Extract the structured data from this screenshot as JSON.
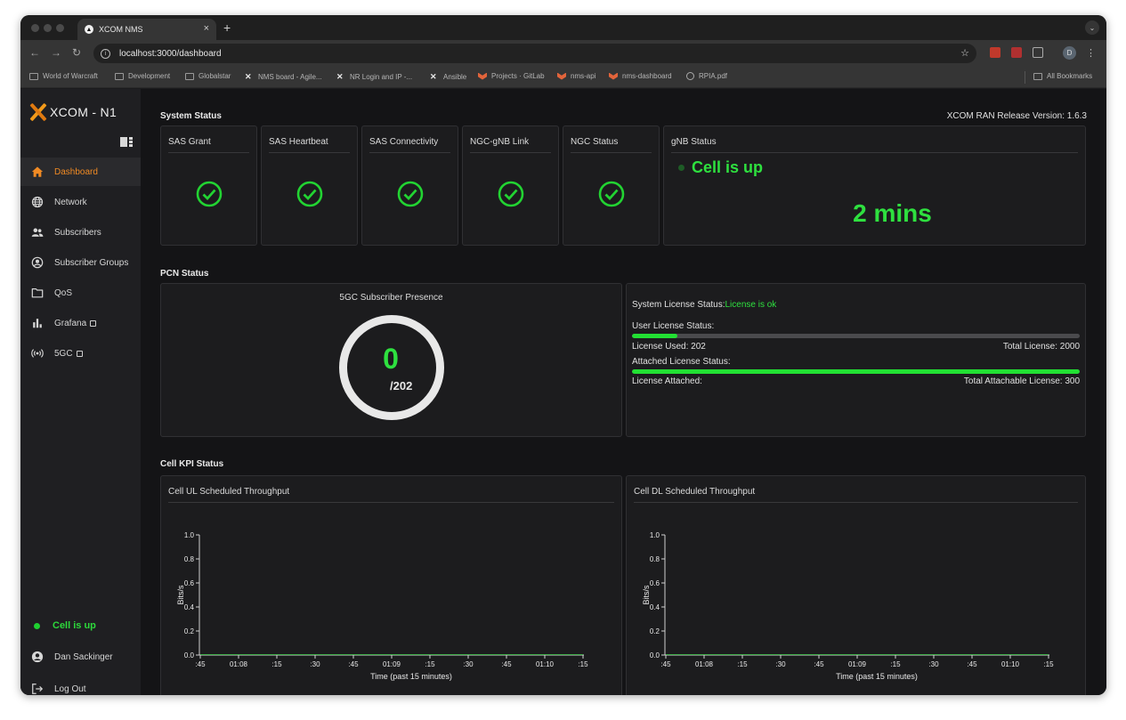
{
  "browser": {
    "tab_title": "XCOM NMS",
    "url": "localhost:3000/dashboard",
    "profile_initial": "D",
    "bookmarks": [
      {
        "label": "World of Warcraft",
        "icon": "folder-icon"
      },
      {
        "label": "Development",
        "icon": "folder-icon"
      },
      {
        "label": "Globalstar",
        "icon": "folder-icon"
      },
      {
        "label": "NMS board - Agile...",
        "icon": "xcom-icon"
      },
      {
        "label": "NR Login and IP -...",
        "icon": "xcom-icon"
      },
      {
        "label": "Ansible",
        "icon": "xcom-icon"
      },
      {
        "label": "Projects · GitLab",
        "icon": "gitlab-icon"
      },
      {
        "label": "nms-api",
        "icon": "gitlab-icon"
      },
      {
        "label": "nms-dashboard",
        "icon": "gitlab-icon"
      },
      {
        "label": "RPIA.pdf",
        "icon": "globe-icon"
      }
    ],
    "all_bookmarks": "All Bookmarks"
  },
  "sidebar": {
    "logo_text": "XCOM - N1",
    "items": [
      {
        "label": "Dashboard",
        "icon": "home-icon"
      },
      {
        "label": "Network",
        "icon": "globe-icon"
      },
      {
        "label": "Subscribers",
        "icon": "users-icon"
      },
      {
        "label": "Subscriber Groups",
        "icon": "user-circle-icon"
      },
      {
        "label": "QoS",
        "icon": "folder-icon"
      },
      {
        "label": "Grafana",
        "icon": "bar-chart-icon"
      },
      {
        "label": "5GC",
        "icon": "broadcast-icon"
      }
    ],
    "cell_status": "Cell is up",
    "user_name": "Dan Sackinger",
    "logout": "Log Out"
  },
  "system_status": {
    "title": "System Status",
    "release": "XCOM RAN Release Version: 1.6.3",
    "cards": [
      "SAS Grant",
      "SAS Heartbeat",
      "SAS Connectivity",
      "NGC-gNB Link",
      "NGC Status"
    ],
    "gnb_title": "gNB Status",
    "gnb_state": "Cell is up",
    "gnb_uptime": "2 mins"
  },
  "pcn_status": {
    "title": "PCN Status",
    "presence_title": "5GC Subscriber Presence",
    "presence_value": "0",
    "presence_total": "/202",
    "license_label": "System License Status:",
    "license_state": "License is ok",
    "user_license_label": "User License Status:",
    "license_used": "License Used: 202",
    "total_license": "Total License: 2000",
    "user_license_fraction": 0.101,
    "attached_label": "Attached License Status:",
    "license_attached": "License Attached:",
    "total_attachable": "Total Attachable License: 300",
    "attached_fraction": 1.0
  },
  "cell_kpi": {
    "title": "Cell KPI Status",
    "ul_title": "Cell UL Scheduled Throughput",
    "dl_title": "Cell DL Scheduled Throughput"
  },
  "chart_data": [
    {
      "type": "line",
      "title": "Cell UL Scheduled Throughput",
      "xlabel": "Time (past 15 minutes)",
      "ylabel": "Bits/s",
      "ylim": [
        0,
        1.0
      ],
      "yticks": [
        "0.0",
        "0.2",
        "0.4",
        "0.6",
        "0.8",
        "1.0"
      ],
      "xticks": [
        ":45",
        "01:08",
        ":15",
        ":30",
        ":45",
        "01:09",
        ":15",
        ":30",
        ":45",
        "01:10",
        ":15"
      ],
      "series": [
        {
          "values": [
            0,
            0,
            0,
            0,
            0,
            0,
            0,
            0,
            0,
            0,
            0
          ]
        }
      ]
    },
    {
      "type": "line",
      "title": "Cell DL Scheduled Throughput",
      "xlabel": "Time (past 15 minutes)",
      "ylabel": "Bits/s",
      "ylim": [
        0,
        1.0
      ],
      "yticks": [
        "0.0",
        "0.2",
        "0.4",
        "0.6",
        "0.8",
        "1.0"
      ],
      "xticks": [
        ":45",
        "01:08",
        ":15",
        ":30",
        ":45",
        "01:09",
        ":15",
        ":30",
        ":45",
        "01:10",
        ":15"
      ],
      "series": [
        {
          "values": [
            0,
            0,
            0,
            0,
            0,
            0,
            0,
            0,
            0,
            0,
            0
          ]
        }
      ]
    }
  ],
  "colors": {
    "accent": "#f08a24",
    "ok_green": "#2ee03f",
    "panel": "#1c1c1e"
  }
}
